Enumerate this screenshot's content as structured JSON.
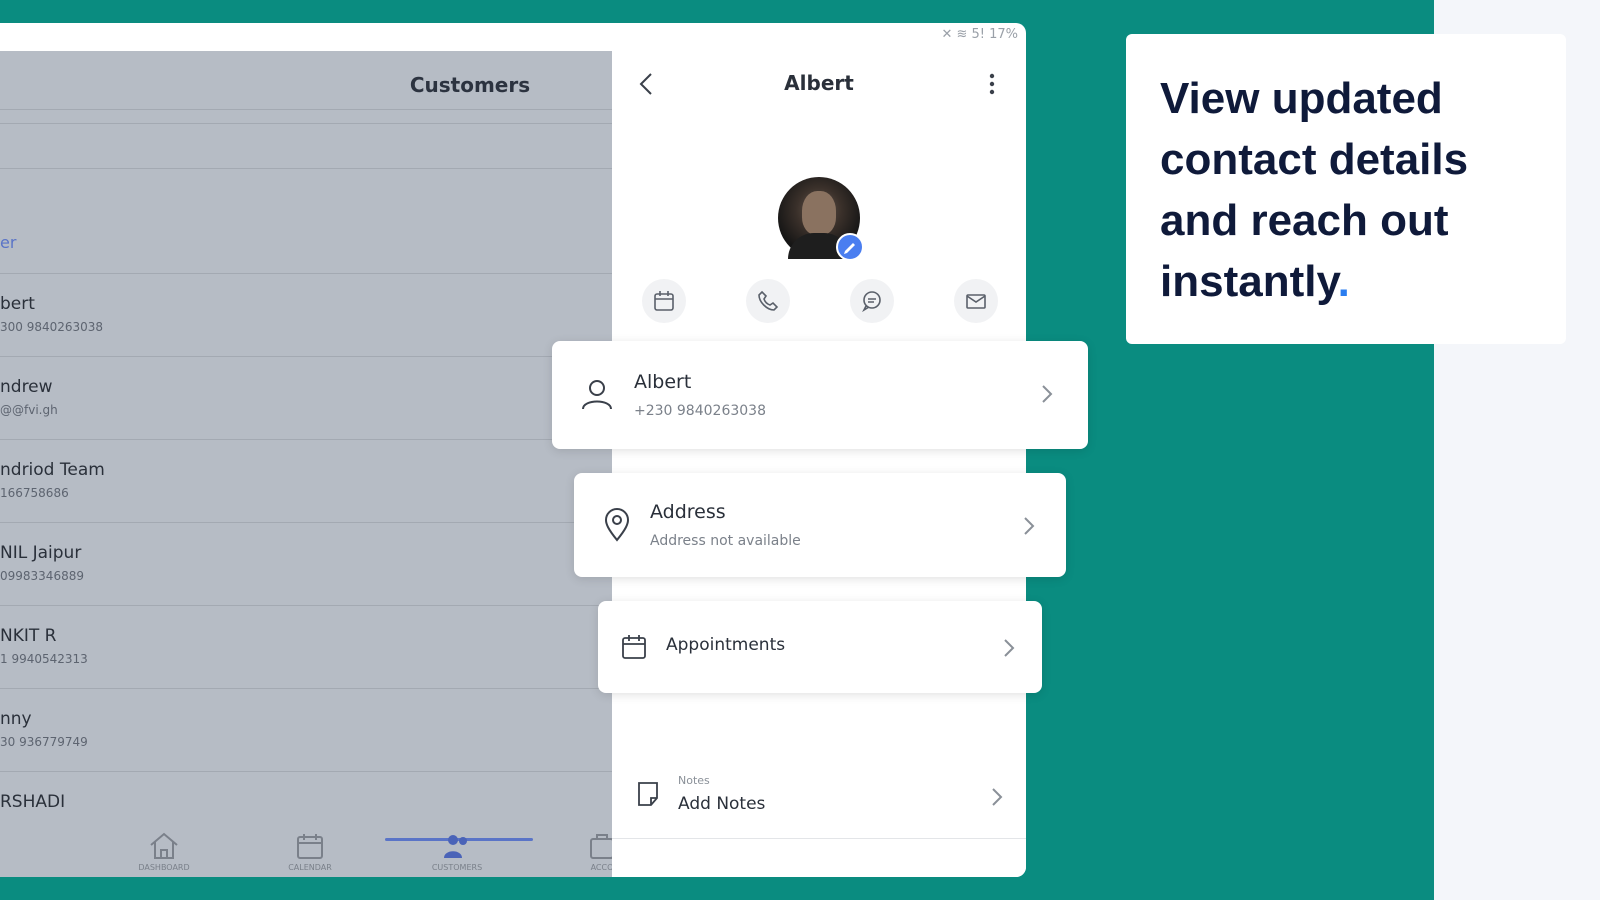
{
  "status_bar": {
    "text": "✕ ≋ 5! 17%"
  },
  "list": {
    "title": "Customers",
    "filter_link": "er",
    "customers": [
      {
        "name": "bert",
        "sub": "300 9840263038"
      },
      {
        "name": "ndrew",
        "sub": "@@fvi.gh"
      },
      {
        "name": "ndriod Team",
        "sub": "166758686"
      },
      {
        "name": "NIL Jaipur",
        "sub": "09983346889"
      },
      {
        "name": "NKIT R",
        "sub": "1 9940542313"
      },
      {
        "name": "nny",
        "sub": "30 936779749"
      },
      {
        "name": "RSHADI",
        "sub": ""
      }
    ],
    "tabs": [
      "DASHBOARD",
      "CALENDAR",
      "CUSTOMERS",
      "ACCO"
    ]
  },
  "detail": {
    "title": "Albert",
    "contact": {
      "name": "Albert",
      "phone": "+230 9840263038"
    },
    "address": {
      "title": "Address",
      "value": "Address not available"
    },
    "appointments": {
      "title": "Appointments"
    },
    "notes": {
      "label": "Notes",
      "value": "Add Notes"
    }
  },
  "promo": {
    "text": "View updated contact details and reach out instantly",
    "dot": "."
  },
  "colors": {
    "teal": "#0a8c80",
    "accent": "#4a7ef0",
    "heading": "#0f1a3a"
  }
}
